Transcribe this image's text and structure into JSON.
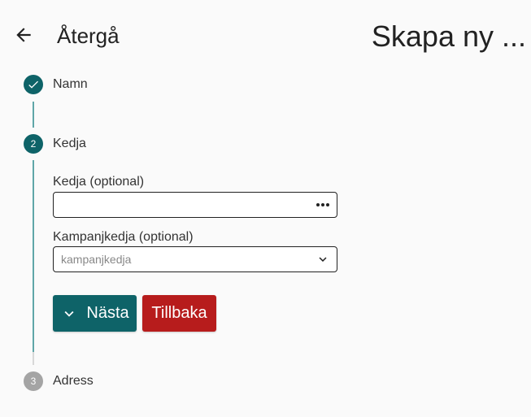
{
  "header": {
    "back_label": "Återgå",
    "title": "Skapa ny ..."
  },
  "steps": [
    {
      "label": "Namn",
      "state": "done"
    },
    {
      "label": "Kedja",
      "number": "2",
      "state": "active"
    },
    {
      "label": "Adress",
      "number": "3",
      "state": "pending"
    }
  ],
  "form": {
    "chain_label": "Kedja (optional)",
    "chain_value": "",
    "campaign_label": "Kampanjkedja (optional)",
    "campaign_placeholder": "kampanjkedja"
  },
  "buttons": {
    "next_label": "Nästa",
    "back_label": "Tillbaka"
  },
  "colors": {
    "primary": "#0e6368",
    "danger": "#b71c1c",
    "pending": "#a4a4a4"
  }
}
